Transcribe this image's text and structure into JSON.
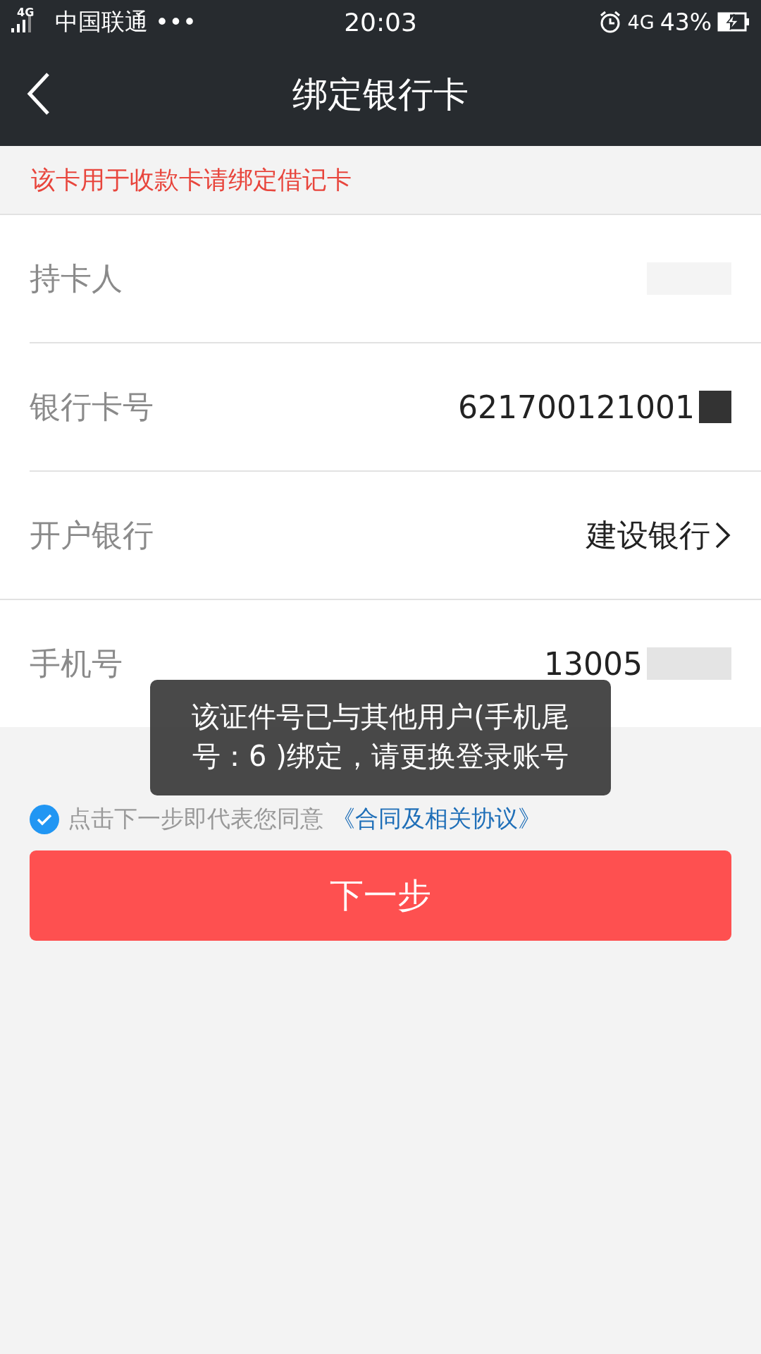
{
  "status_bar": {
    "network": "4G",
    "carrier": "中国联通",
    "more": "•••",
    "time": "20:03",
    "data_type": "4G",
    "battery": "43%"
  },
  "header": {
    "title": "绑定银行卡"
  },
  "notice": "该卡用于收款卡请绑定借记卡",
  "fields": [
    {
      "label": "持卡人",
      "kind": "redacted"
    },
    {
      "label": "银行卡号",
      "value": "621700121001",
      "kind": "redacted_text"
    },
    {
      "label": "开户银行",
      "value": "建设银行",
      "kind": "select"
    },
    {
      "label": "手机号",
      "value": "13005",
      "kind": "redacted_text"
    }
  ],
  "agreement": {
    "checked": true,
    "text": "点击下一步即代表您同意",
    "link": "《合同及相关协议》"
  },
  "next_button": "下一步",
  "toast": "该证件号已与其他用户(手机尾号：6   )绑定，请更换登录账号"
}
